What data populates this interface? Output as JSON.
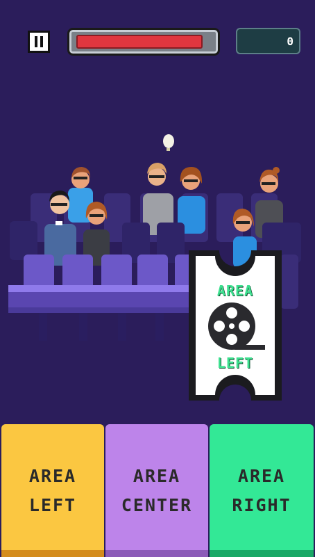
{
  "hud": {
    "health_fraction": 0.95,
    "score": "0",
    "colors": {
      "health": "#e0363f",
      "score_bg": "#1e3d44"
    }
  },
  "ticket": {
    "line1": "AREA",
    "line2": "LEFT",
    "icon": "film-reel-icon"
  },
  "buttons": [
    {
      "line1": "AREA",
      "line2": "LEFT",
      "color": "#fbc741",
      "bar": "#d48c1c"
    },
    {
      "line1": "AREA",
      "line2": "CENTER",
      "color": "#bd84ea",
      "bar": "#8c5cb8"
    },
    {
      "line1": "AREA",
      "line2": "RIGHT",
      "color": "#33e896",
      "bar": "#1aa866"
    }
  ],
  "background_color": "#2b1d5b"
}
